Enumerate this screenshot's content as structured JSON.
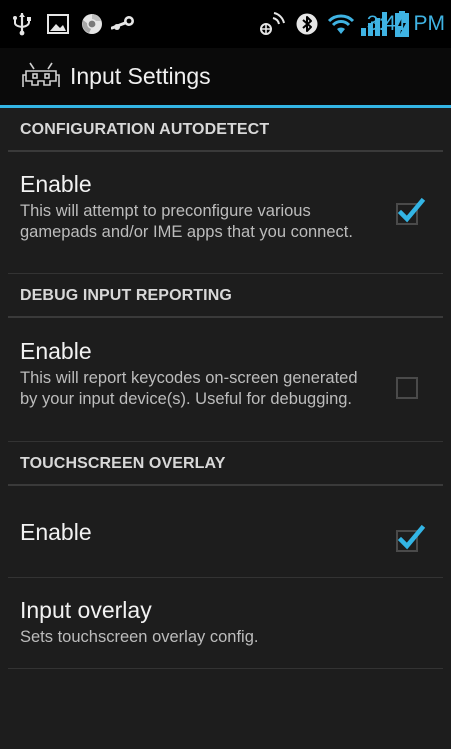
{
  "status_bar": {
    "time": "3:41 PM",
    "icons": [
      "usb-icon",
      "picture-icon",
      "chrome-icon",
      "steam-icon",
      "nfc-icon",
      "bluetooth-icon",
      "wifi-icon",
      "signal-icon",
      "battery-charging-icon"
    ],
    "accent_color": "#33b5e5"
  },
  "action_bar": {
    "title": "Input Settings",
    "icon": "gamepad-invader-icon"
  },
  "categories": [
    {
      "label": "CONFIGURATION AUTODETECT",
      "prefs": [
        {
          "title": "Enable",
          "summary": "This will attempt to preconfigure various gamepads and/or IME apps that you connect.",
          "checked": true
        }
      ]
    },
    {
      "label": "DEBUG INPUT REPORTING",
      "prefs": [
        {
          "title": "Enable",
          "summary": "This will report keycodes on-screen generated by your input device(s). Useful for debugging.",
          "checked": false
        }
      ]
    },
    {
      "label": "TOUCHSCREEN OVERLAY",
      "prefs": [
        {
          "title": "Enable",
          "checked": true
        },
        {
          "title": "Input overlay",
          "summary": "Sets touchscreen overlay config."
        }
      ]
    }
  ]
}
